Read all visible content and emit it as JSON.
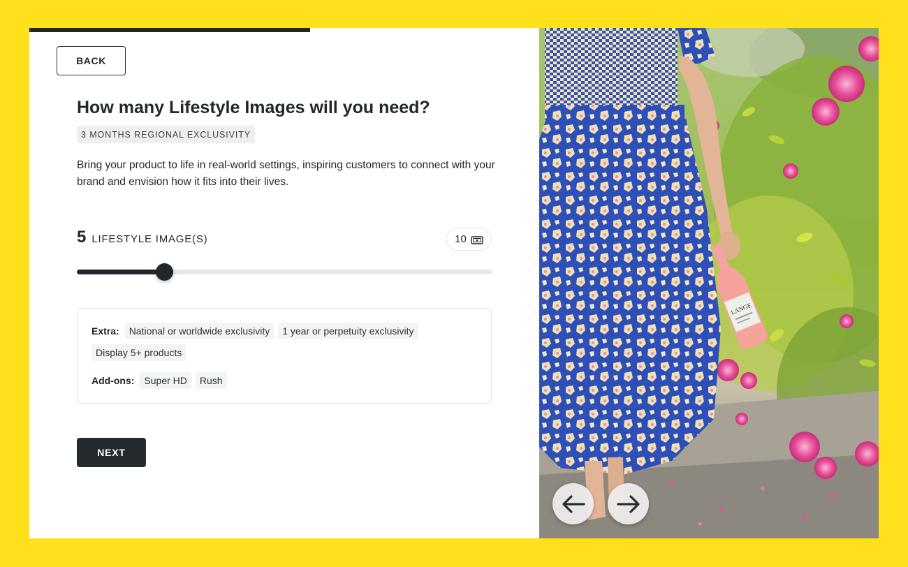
{
  "progress": {
    "fraction": 0.55
  },
  "toolbar": {
    "back_label": "BACK",
    "next_label": "NEXT"
  },
  "question": {
    "title": "How many Lifestyle Images will you need?",
    "badge": "3 MONTHS REGIONAL EXCLUSIVITY",
    "description": "Bring your product to life in real-world settings, inspiring customers to connect with your brand and envision how it fits into their lives."
  },
  "quantity": {
    "value": "5",
    "label": "LIFESTYLE IMAGE(S)",
    "credits": "10",
    "credits_icon": "ticket-icon",
    "slider": {
      "min": 1,
      "max": 20,
      "value": 5
    }
  },
  "extras": {
    "extra_label": "Extra:",
    "extra_items": [
      "National or worldwide exclusivity",
      "1 year or perpetuity exclusivity",
      "Display 5+ products"
    ],
    "addons_label": "Add-ons:",
    "addon_items": [
      "Super HD",
      "Rush"
    ]
  },
  "gallery": {
    "image": "woman-in-floral-dress-holding-rose-wine-bottle-photo",
    "prev_icon": "arrow-left-icon",
    "next_icon": "arrow-right-icon"
  },
  "colors": {
    "background": "#FEE01B",
    "primary": "#252a2f",
    "dress_blue": "#2f4fb8",
    "flower_pink": "#e8509a"
  }
}
